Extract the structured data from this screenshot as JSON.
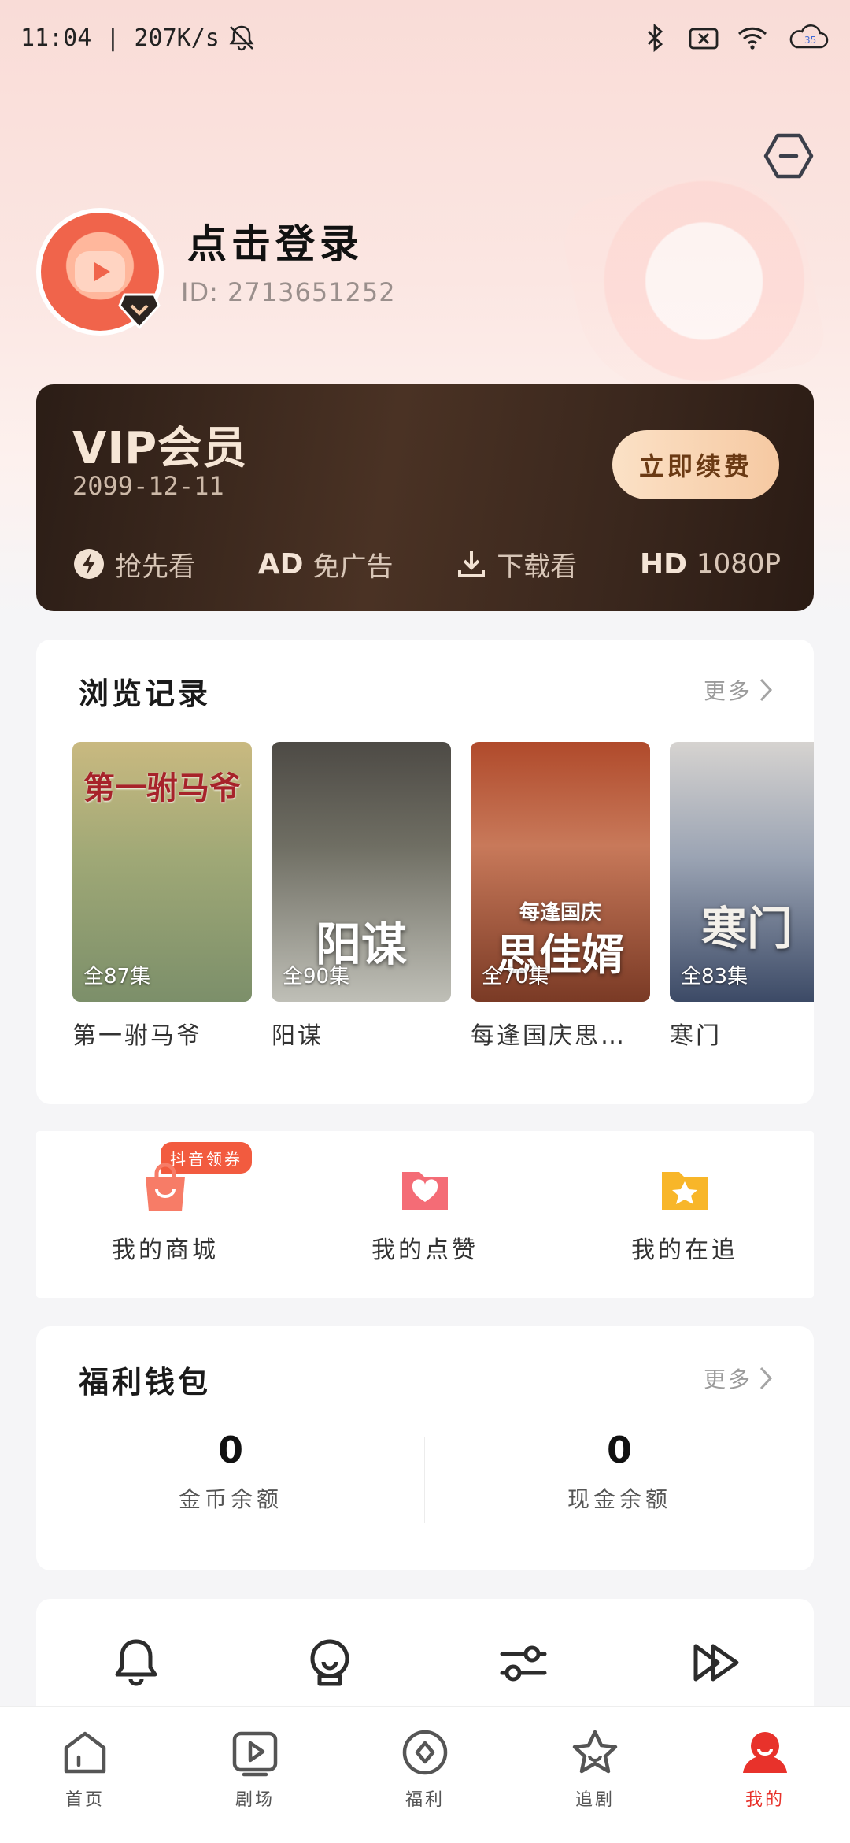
{
  "status_bar": {
    "time_speed": "11:04 | 207K/s",
    "battery": "35"
  },
  "profile": {
    "login_title": "点击登录",
    "user_id": "ID: 2713651252"
  },
  "vip": {
    "title": "VIP会员",
    "expiry": "2099-12-11",
    "renew_label": "立即续费",
    "perks": [
      {
        "badge": "",
        "label": "抢先看",
        "icon": "lightning-icon"
      },
      {
        "badge": "AD",
        "label": "免广告",
        "icon": ""
      },
      {
        "badge": "",
        "label": "下载看",
        "icon": "download-icon"
      },
      {
        "badge": "HD",
        "label": "1080P",
        "icon": ""
      }
    ]
  },
  "history": {
    "title": "浏览记录",
    "more": "更多",
    "items": [
      {
        "name": "第一驸马爷",
        "episodes": "全87集",
        "overlay": "第一驸马爷"
      },
      {
        "name": "阳谋",
        "episodes": "全90集",
        "overlay": "阳谋"
      },
      {
        "name": "每逢国庆思…",
        "episodes": "全70集",
        "overlay": "思佳婿",
        "overlay_sub": "每逢国庆"
      },
      {
        "name": "寒门",
        "episodes": "全83集",
        "overlay": "寒门"
      }
    ]
  },
  "shortcuts": {
    "coupon_tag": "抖音领券",
    "items": [
      {
        "label": "我的商城",
        "icon": "shopping-bag-icon"
      },
      {
        "label": "我的点赞",
        "icon": "heart-folder-icon"
      },
      {
        "label": "我的在追",
        "icon": "star-folder-icon"
      }
    ]
  },
  "wallet": {
    "title": "福利钱包",
    "more": "更多",
    "coins_value": "0",
    "coins_label": "金币余额",
    "cash_value": "0",
    "cash_label": "现金余额"
  },
  "tools": [
    {
      "icon": "bell-icon"
    },
    {
      "icon": "headset-icon"
    },
    {
      "icon": "settings-sliders-icon"
    },
    {
      "icon": "fast-forward-icon"
    }
  ],
  "bottom_nav": [
    {
      "label": "首页",
      "icon": "home-icon"
    },
    {
      "label": "剧场",
      "icon": "theater-icon"
    },
    {
      "label": "福利",
      "icon": "welfare-icon"
    },
    {
      "label": "追剧",
      "icon": "star-icon"
    },
    {
      "label": "我的",
      "icon": "profile-icon",
      "active": true
    }
  ],
  "colors": {
    "accent": "#e8322b",
    "vip_gold": "#f6c9a2",
    "hero_pink": "#f9dcd7"
  }
}
